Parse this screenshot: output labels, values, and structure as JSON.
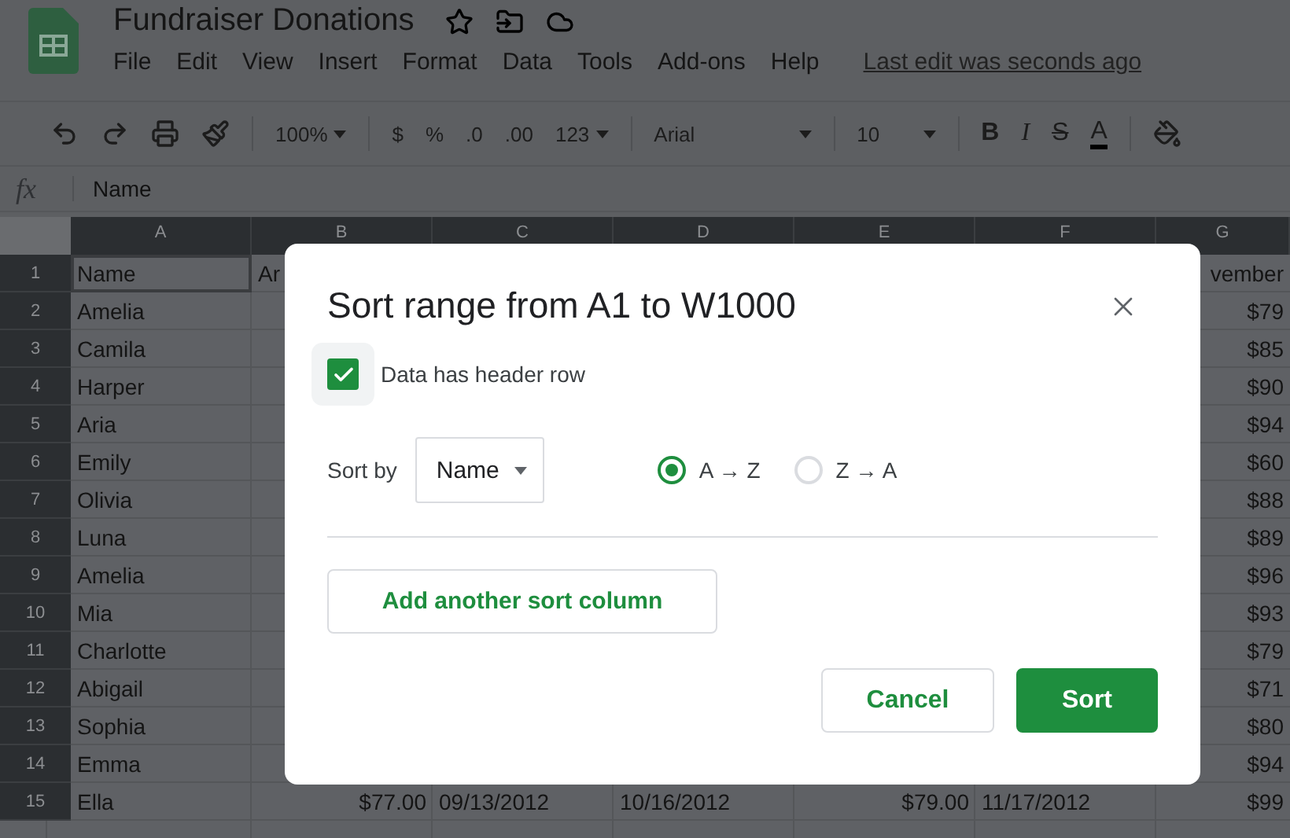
{
  "app": {
    "title": "Fundraiser Donations",
    "menu": [
      "File",
      "Edit",
      "View",
      "Insert",
      "Format",
      "Data",
      "Tools",
      "Add-ons",
      "Help"
    ],
    "last_edit": "Last edit was seconds ago"
  },
  "toolbar": {
    "zoom": "100%",
    "currency": "$",
    "percent": "%",
    "decimal_decrease": ".0",
    "decimal_increase": ".00",
    "number_format": "123",
    "font": "Arial",
    "font_size": "10",
    "bold": "B",
    "italic": "I",
    "strikethrough": "S",
    "text_color": "A"
  },
  "formula_bar": {
    "fx": "fx",
    "value": "Name"
  },
  "sheet": {
    "columns": [
      "A",
      "B",
      "C",
      "D",
      "E",
      "F",
      "G"
    ],
    "rows": [
      {
        "number": "1",
        "cells": {
          "A": "Name",
          "B": "Ar",
          "G": "vember"
        }
      },
      {
        "number": "2",
        "cells": {
          "A": "Amelia",
          "G": "$79"
        }
      },
      {
        "number": "3",
        "cells": {
          "A": "Camila",
          "G": "$85"
        }
      },
      {
        "number": "4",
        "cells": {
          "A": "Harper",
          "G": "$90"
        }
      },
      {
        "number": "5",
        "cells": {
          "A": "Aria",
          "G": "$94"
        }
      },
      {
        "number": "6",
        "cells": {
          "A": "Emily",
          "G": "$60"
        }
      },
      {
        "number": "7",
        "cells": {
          "A": "Olivia",
          "G": "$88"
        }
      },
      {
        "number": "8",
        "cells": {
          "A": "Luna",
          "G": "$89"
        }
      },
      {
        "number": "9",
        "cells": {
          "A": "Amelia",
          "G": "$96"
        }
      },
      {
        "number": "10",
        "cells": {
          "A": "Mia",
          "G": "$93"
        }
      },
      {
        "number": "11",
        "cells": {
          "A": "Charlotte",
          "G": "$79"
        }
      },
      {
        "number": "12",
        "cells": {
          "A": "Abigail",
          "G": "$71"
        }
      },
      {
        "number": "13",
        "cells": {
          "A": "Sophia",
          "G": "$80"
        }
      },
      {
        "number": "14",
        "cells": {
          "A": "Emma",
          "G": "$94"
        }
      },
      {
        "number": "15",
        "cells": {
          "A": "Ella",
          "B": "$77.00",
          "C": "09/13/2012",
          "D": "10/16/2012",
          "E": "$79.00",
          "F": "11/17/2012",
          "G": "$99"
        }
      }
    ]
  },
  "dialog": {
    "title": "Sort range from A1 to W1000",
    "header_row": {
      "label": "Data has header row",
      "checked": true
    },
    "sort_by": {
      "label": "Sort by",
      "column": "Name"
    },
    "order": [
      {
        "label": "A → Z",
        "selected": true
      },
      {
        "label": "Z → A",
        "selected": false
      }
    ],
    "add_column": "Add another sort column",
    "buttons": [
      {
        "label": "Cancel",
        "kind": "secondary"
      },
      {
        "label": "Sort",
        "kind": "primary"
      }
    ]
  }
}
